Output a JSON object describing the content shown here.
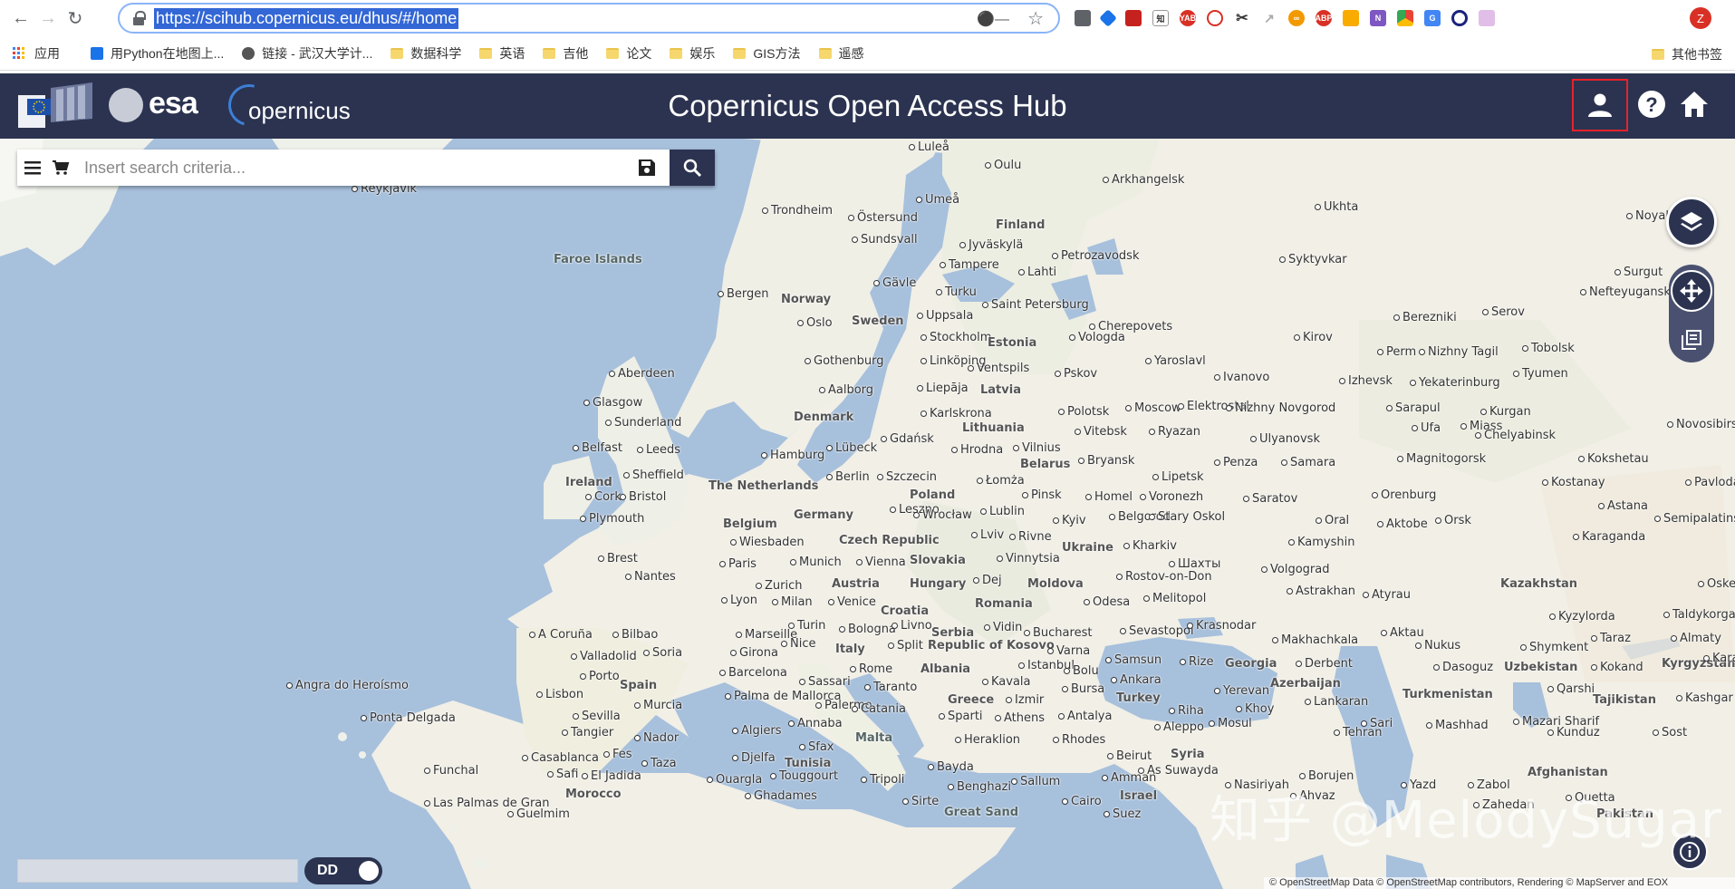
{
  "browser": {
    "url": "https://scihub.copernicus.eu/dhus/#/home",
    "nav_icons": [
      "back-arrow-icon",
      "forward-arrow-icon",
      "reload-icon"
    ],
    "profile_initial": "Z"
  },
  "bookmarks": {
    "apps_label": "应用",
    "items": [
      {
        "label": "用Python在地图上...",
        "icon": "bookmark-favicon-blue"
      },
      {
        "label": "链接 - 武汉大学计...",
        "icon": "globe-icon"
      },
      {
        "label": "数据科学",
        "icon": "folder-icon"
      },
      {
        "label": "英语",
        "icon": "folder-icon"
      },
      {
        "label": "吉他",
        "icon": "folder-icon"
      },
      {
        "label": "论文",
        "icon": "folder-icon"
      },
      {
        "label": "娱乐",
        "icon": "folder-icon"
      },
      {
        "label": "GIS方法",
        "icon": "folder-icon"
      },
      {
        "label": "遥感",
        "icon": "folder-icon"
      }
    ],
    "other_label": "其他书签"
  },
  "header": {
    "esa_text": "esa",
    "copernicus_text": "opernicus",
    "title": "Copernicus Open Access Hub",
    "colors": {
      "bar": "#2b3350",
      "highlight": "#e8222a"
    }
  },
  "search": {
    "placeholder": "Insert search criteria...",
    "value": ""
  },
  "map": {
    "toggle_label": "DD",
    "watermark": "知乎 @MelodySugar",
    "attribution": "© OpenStreetMap Data © OpenStreetMap contributors, Rendering © MapServer and EOX",
    "labels": [
      {
        "text": "Luleå",
        "kind": "city"
      },
      {
        "text": "Oulu",
        "kind": "city"
      },
      {
        "text": "Arkhangelsk",
        "kind": "city"
      },
      {
        "text": "Reykjavík",
        "kind": "city"
      },
      {
        "text": "Trondheim",
        "kind": "city"
      },
      {
        "text": "Östersund",
        "kind": "city"
      },
      {
        "text": "Umeå",
        "kind": "city"
      },
      {
        "text": "Finland",
        "kind": "country"
      },
      {
        "text": "Ukhta",
        "kind": "city"
      },
      {
        "text": "Noyabrsk",
        "kind": "city"
      },
      {
        "text": "Sundsvall",
        "kind": "city"
      },
      {
        "text": "Jyväskylä",
        "kind": "city"
      },
      {
        "text": "Faroe Islands",
        "kind": "sea"
      },
      {
        "text": "Petrozavodsk",
        "kind": "city"
      },
      {
        "text": "Syktyvkar",
        "kind": "city"
      },
      {
        "text": "Tampere",
        "kind": "city"
      },
      {
        "text": "Lahti",
        "kind": "city"
      },
      {
        "text": "Surgut",
        "kind": "city"
      },
      {
        "text": "Gävle",
        "kind": "city"
      },
      {
        "text": "Nefteyugansk",
        "kind": "city"
      },
      {
        "text": "Bergen",
        "kind": "city"
      },
      {
        "text": "Norway",
        "kind": "country"
      },
      {
        "text": "Turku",
        "kind": "city"
      },
      {
        "text": "Saint Petersburg",
        "kind": "city"
      },
      {
        "text": "Oslo",
        "kind": "city"
      },
      {
        "text": "Sweden",
        "kind": "country"
      },
      {
        "text": "Uppsala",
        "kind": "city"
      },
      {
        "text": "Berezniki",
        "kind": "city"
      },
      {
        "text": "Serov",
        "kind": "city"
      },
      {
        "text": "Cherepovets",
        "kind": "city"
      },
      {
        "text": "Stockholm",
        "kind": "city"
      },
      {
        "text": "Estonia",
        "kind": "country"
      },
      {
        "text": "Vologda",
        "kind": "city"
      },
      {
        "text": "Kirov",
        "kind": "city"
      },
      {
        "text": "Perm",
        "kind": "city"
      },
      {
        "text": "Nizhny Tagil",
        "kind": "city"
      },
      {
        "text": "Tobolsk",
        "kind": "city"
      },
      {
        "text": "Aberdeen",
        "kind": "city"
      },
      {
        "text": "Gothenburg",
        "kind": "city"
      },
      {
        "text": "Linköping",
        "kind": "city"
      },
      {
        "text": "Ventspils",
        "kind": "city"
      },
      {
        "text": "Pskov",
        "kind": "city"
      },
      {
        "text": "Yaroslavl",
        "kind": "city"
      },
      {
        "text": "Izhevsk",
        "kind": "city"
      },
      {
        "text": "Yekaterinburg",
        "kind": "city"
      },
      {
        "text": "Tyumen",
        "kind": "city"
      },
      {
        "text": "Ivanovo",
        "kind": "city"
      },
      {
        "text": "Glasgow",
        "kind": "city"
      },
      {
        "text": "Aalborg",
        "kind": "city"
      },
      {
        "text": "Liepāja",
        "kind": "city"
      },
      {
        "text": "Latvia",
        "kind": "country"
      },
      {
        "text": "Moscow",
        "kind": "city"
      },
      {
        "text": "Elektrostal",
        "kind": "city"
      },
      {
        "text": "Nizhny Novgorod",
        "kind": "city"
      },
      {
        "text": "Sarapul",
        "kind": "city"
      },
      {
        "text": "Kurgan",
        "kind": "city"
      },
      {
        "text": "Sunderland",
        "kind": "city"
      },
      {
        "text": "Denmark",
        "kind": "country"
      },
      {
        "text": "Karlskrona",
        "kind": "city"
      },
      {
        "text": "Polotsk",
        "kind": "city"
      },
      {
        "text": "Ufa",
        "kind": "city"
      },
      {
        "text": "Miass",
        "kind": "city"
      },
      {
        "text": "Novosibirsk",
        "kind": "city"
      },
      {
        "text": "Lithuania",
        "kind": "country"
      },
      {
        "text": "Ryazan",
        "kind": "city"
      },
      {
        "text": "Ulyanovsk",
        "kind": "city"
      },
      {
        "text": "Chelyabinsk",
        "kind": "city"
      },
      {
        "text": "Belfast",
        "kind": "city"
      },
      {
        "text": "Leeds",
        "kind": "city"
      },
      {
        "text": "Gdańsk",
        "kind": "city"
      },
      {
        "text": "Vitebsk",
        "kind": "city"
      },
      {
        "text": "Hamburg",
        "kind": "city"
      },
      {
        "text": "Lübeck",
        "kind": "city"
      },
      {
        "text": "Hrodna",
        "kind": "city"
      },
      {
        "text": "Vilnius",
        "kind": "city"
      },
      {
        "text": "Bryansk",
        "kind": "city"
      },
      {
        "text": "Penza",
        "kind": "city"
      },
      {
        "text": "Samara",
        "kind": "city"
      },
      {
        "text": "Magnitogorsk",
        "kind": "city"
      },
      {
        "text": "Kokshetau",
        "kind": "city"
      },
      {
        "text": "Pavlodar",
        "kind": "city"
      },
      {
        "text": "Ireland",
        "kind": "country"
      },
      {
        "text": "Sheffield",
        "kind": "city"
      },
      {
        "text": "Berlin",
        "kind": "city"
      },
      {
        "text": "Szczecin",
        "kind": "city"
      },
      {
        "text": "Łomża",
        "kind": "city"
      },
      {
        "text": "Belarus",
        "kind": "country"
      },
      {
        "text": "Lipetsk",
        "kind": "city"
      },
      {
        "text": "Kostanay",
        "kind": "city"
      },
      {
        "text": "The Netherlands",
        "kind": "country"
      },
      {
        "text": "Cork",
        "kind": "city"
      },
      {
        "text": "Bristol",
        "kind": "city"
      },
      {
        "text": "Poland",
        "kind": "country"
      },
      {
        "text": "Pinsk",
        "kind": "city"
      },
      {
        "text": "Homel",
        "kind": "city"
      },
      {
        "text": "Voronezh",
        "kind": "city"
      },
      {
        "text": "Saratov",
        "kind": "city"
      },
      {
        "text": "Orenburg",
        "kind": "city"
      },
      {
        "text": "Astana",
        "kind": "city"
      },
      {
        "text": "Plymouth",
        "kind": "city"
      },
      {
        "text": "Belgium",
        "kind": "country"
      },
      {
        "text": "Germany",
        "kind": "country"
      },
      {
        "text": "Leszno",
        "kind": "city"
      },
      {
        "text": "Wrocław",
        "kind": "city"
      },
      {
        "text": "Lublin",
        "kind": "city"
      },
      {
        "text": "Kyiv",
        "kind": "city"
      },
      {
        "text": "Belgorod",
        "kind": "city"
      },
      {
        "text": "Stary Oskol",
        "kind": "city"
      },
      {
        "text": "Oral",
        "kind": "city"
      },
      {
        "text": "Aktobe",
        "kind": "city"
      },
      {
        "text": "Orsk",
        "kind": "city"
      },
      {
        "text": "Semipalatinsk",
        "kind": "city"
      },
      {
        "text": "Karaganda",
        "kind": "city"
      },
      {
        "text": "Wiesbaden",
        "kind": "city"
      },
      {
        "text": "Czech Republic",
        "kind": "country"
      },
      {
        "text": "Lviv",
        "kind": "city"
      },
      {
        "text": "Rivne",
        "kind": "city"
      },
      {
        "text": "Ukraine",
        "kind": "country"
      },
      {
        "text": "Kharkiv",
        "kind": "city"
      },
      {
        "text": "Kamyshin",
        "kind": "city"
      },
      {
        "text": "Brest",
        "kind": "city"
      },
      {
        "text": "Paris",
        "kind": "city"
      },
      {
        "text": "Munich",
        "kind": "city"
      },
      {
        "text": "Vienna",
        "kind": "city"
      },
      {
        "text": "Slovakia",
        "kind": "country"
      },
      {
        "text": "Vinnytsia",
        "kind": "city"
      },
      {
        "text": "Шахты",
        "kind": "city"
      },
      {
        "text": "Volgograd",
        "kind": "city"
      },
      {
        "text": "Nantes",
        "kind": "city"
      },
      {
        "text": "Zurich",
        "kind": "city"
      },
      {
        "text": "Austria",
        "kind": "country"
      },
      {
        "text": "Hungary",
        "kind": "country"
      },
      {
        "text": "Dej",
        "kind": "city"
      },
      {
        "text": "Moldova",
        "kind": "country"
      },
      {
        "text": "Rostov-on-Don",
        "kind": "city"
      },
      {
        "text": "Kazakhstan",
        "kind": "country"
      },
      {
        "text": "Oskemen",
        "kind": "city"
      },
      {
        "text": "Lyon",
        "kind": "city"
      },
      {
        "text": "Milan",
        "kind": "city"
      },
      {
        "text": "Venice",
        "kind": "city"
      },
      {
        "text": "Romania",
        "kind": "country"
      },
      {
        "text": "Odesa",
        "kind": "city"
      },
      {
        "text": "Melitopol",
        "kind": "city"
      },
      {
        "text": "Astrakhan",
        "kind": "city"
      },
      {
        "text": "Atyrau",
        "kind": "city"
      },
      {
        "text": "Kyzylorda",
        "kind": "city"
      },
      {
        "text": "Taldykorgan",
        "kind": "city"
      },
      {
        "text": "Croatia",
        "kind": "country"
      },
      {
        "text": "Turin",
        "kind": "city"
      },
      {
        "text": "Bologna",
        "kind": "city"
      },
      {
        "text": "Livno",
        "kind": "city"
      },
      {
        "text": "Serbia",
        "kind": "country"
      },
      {
        "text": "Vidin",
        "kind": "city"
      },
      {
        "text": "Sevastopol",
        "kind": "city"
      },
      {
        "text": "Krasnodar",
        "kind": "city"
      },
      {
        "text": "Aktau",
        "kind": "city"
      },
      {
        "text": "Almaty",
        "kind": "city"
      },
      {
        "text": "A Coruña",
        "kind": "city"
      },
      {
        "text": "Bilbao",
        "kind": "city"
      },
      {
        "text": "Marseille",
        "kind": "city"
      },
      {
        "text": "Nice",
        "kind": "city"
      },
      {
        "text": "Split",
        "kind": "city"
      },
      {
        "text": "Republic of Kosovo",
        "kind": "country"
      },
      {
        "text": "Bucharest",
        "kind": "city"
      },
      {
        "text": "Varna",
        "kind": "city"
      },
      {
        "text": "Makhachkala",
        "kind": "city"
      },
      {
        "text": "Taraz",
        "kind": "city"
      },
      {
        "text": "Valladolid",
        "kind": "city"
      },
      {
        "text": "Soria",
        "kind": "city"
      },
      {
        "text": "Girona",
        "kind": "city"
      },
      {
        "text": "Italy",
        "kind": "country"
      },
      {
        "text": "Rome",
        "kind": "city"
      },
      {
        "text": "Albania",
        "kind": "country"
      },
      {
        "text": "Istanbul",
        "kind": "city"
      },
      {
        "text": "Bolu",
        "kind": "city"
      },
      {
        "text": "Samsun",
        "kind": "city"
      },
      {
        "text": "Rize",
        "kind": "city"
      },
      {
        "text": "Georgia",
        "kind": "country"
      },
      {
        "text": "Derbent",
        "kind": "city"
      },
      {
        "text": "Nukus",
        "kind": "city"
      },
      {
        "text": "Shymkent",
        "kind": "city"
      },
      {
        "text": "Kyrgyzstan",
        "kind": "country"
      },
      {
        "text": "Karakol",
        "kind": "city"
      },
      {
        "text": "Porto",
        "kind": "city"
      },
      {
        "text": "Barcelona",
        "kind": "city"
      },
      {
        "text": "Sassari",
        "kind": "city"
      },
      {
        "text": "Taranto",
        "kind": "city"
      },
      {
        "text": "Kavala",
        "kind": "city"
      },
      {
        "text": "Bursa",
        "kind": "city"
      },
      {
        "text": "Ankara",
        "kind": "city"
      },
      {
        "text": "Azerbaijan",
        "kind": "country"
      },
      {
        "text": "Dasoguz",
        "kind": "city"
      },
      {
        "text": "Uzbekistan",
        "kind": "country"
      },
      {
        "text": "Kokand",
        "kind": "city"
      },
      {
        "text": "Angra do Heroísmo",
        "kind": "city"
      },
      {
        "text": "Lisbon",
        "kind": "city"
      },
      {
        "text": "Spain",
        "kind": "country"
      },
      {
        "text": "Murcia",
        "kind": "city"
      },
      {
        "text": "Palma de Mallorca",
        "kind": "city"
      },
      {
        "text": "Palermo",
        "kind": "city"
      },
      {
        "text": "Greece",
        "kind": "country"
      },
      {
        "text": "Izmir",
        "kind": "city"
      },
      {
        "text": "Turkey",
        "kind": "country"
      },
      {
        "text": "Yerevan",
        "kind": "city"
      },
      {
        "text": "Lankaran",
        "kind": "city"
      },
      {
        "text": "Turkmenistan",
        "kind": "country"
      },
      {
        "text": "Qarshi",
        "kind": "city"
      },
      {
        "text": "Tajikistan",
        "kind": "country"
      },
      {
        "text": "Kashgar",
        "kind": "city"
      },
      {
        "text": "Ponta Delgada",
        "kind": "city"
      },
      {
        "text": "Sevilla",
        "kind": "city"
      },
      {
        "text": "Algiers",
        "kind": "city"
      },
      {
        "text": "Catania",
        "kind": "city"
      },
      {
        "text": "Sparti",
        "kind": "city"
      },
      {
        "text": "Athens",
        "kind": "city"
      },
      {
        "text": "Antalya",
        "kind": "city"
      },
      {
        "text": "Riha",
        "kind": "city"
      },
      {
        "text": "Khoy",
        "kind": "city"
      },
      {
        "text": "Sari",
        "kind": "city"
      },
      {
        "text": "Mashhad",
        "kind": "city"
      },
      {
        "text": "Mazari Sharif",
        "kind": "city"
      },
      {
        "text": "Annaba",
        "kind": "city"
      },
      {
        "text": "Mosul",
        "kind": "city"
      },
      {
        "text": "Tangier",
        "kind": "city"
      },
      {
        "text": "Nador",
        "kind": "city"
      },
      {
        "text": "Malta",
        "kind": "sea"
      },
      {
        "text": "Heraklion",
        "kind": "city"
      },
      {
        "text": "Rhodes",
        "kind": "city"
      },
      {
        "text": "Aleppo",
        "kind": "city"
      },
      {
        "text": "Tehran",
        "kind": "city"
      },
      {
        "text": "Kunduz",
        "kind": "city"
      },
      {
        "text": "Sost",
        "kind": "city"
      },
      {
        "text": "Sfax",
        "kind": "city"
      },
      {
        "text": "Syria",
        "kind": "country"
      },
      {
        "text": "Afghanistan",
        "kind": "country"
      },
      {
        "text": "Casablanca",
        "kind": "city"
      },
      {
        "text": "Fes",
        "kind": "city"
      },
      {
        "text": "Taza",
        "kind": "city"
      },
      {
        "text": "Djelfa",
        "kind": "city"
      },
      {
        "text": "Tunisia",
        "kind": "country"
      },
      {
        "text": "Beirut",
        "kind": "city"
      },
      {
        "text": "As Suwayda",
        "kind": "city"
      },
      {
        "text": "Funchal",
        "kind": "city"
      },
      {
        "text": "Safi",
        "kind": "city"
      },
      {
        "text": "El Jadida",
        "kind": "city"
      },
      {
        "text": "Ouargla",
        "kind": "city"
      },
      {
        "text": "Touggourt",
        "kind": "city"
      },
      {
        "text": "Tripoli",
        "kind": "city"
      },
      {
        "text": "Bayda",
        "kind": "city"
      },
      {
        "text": "Amman",
        "kind": "city"
      },
      {
        "text": "Nasiriyah",
        "kind": "city"
      },
      {
        "text": "Borujen",
        "kind": "city"
      },
      {
        "text": "Yazd",
        "kind": "city"
      },
      {
        "text": "Zabol",
        "kind": "city"
      },
      {
        "text": "Morocco",
        "kind": "country"
      },
      {
        "text": "Benghazi",
        "kind": "city"
      },
      {
        "text": "Sallum",
        "kind": "city"
      },
      {
        "text": "Israel",
        "kind": "country"
      },
      {
        "text": "Ahvaz",
        "kind": "city"
      },
      {
        "text": "Zahedan",
        "kind": "city"
      },
      {
        "text": "Quetta",
        "kind": "city"
      },
      {
        "text": "Pakistan",
        "kind": "country"
      },
      {
        "text": "Ghadames",
        "kind": "city"
      },
      {
        "text": "Sirte",
        "kind": "city"
      },
      {
        "text": "Cairo",
        "kind": "city"
      },
      {
        "text": "Las Palmas de Gran",
        "kind": "city"
      },
      {
        "text": "Guelmim",
        "kind": "city"
      },
      {
        "text": "Great Sand",
        "kind": "sea"
      },
      {
        "text": "Suez",
        "kind": "city"
      }
    ]
  }
}
